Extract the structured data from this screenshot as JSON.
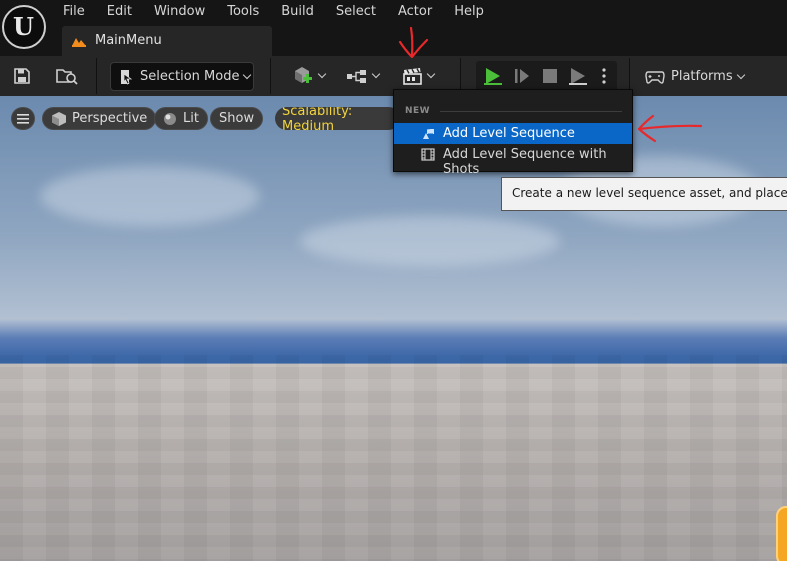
{
  "menu_bar": {
    "items": [
      "File",
      "Edit",
      "Window",
      "Tools",
      "Build",
      "Select",
      "Actor",
      "Help"
    ]
  },
  "document_tab": {
    "label": "MainMenu",
    "icon": "level-icon"
  },
  "toolbar": {
    "selection_mode_label": "Selection Mode",
    "platforms_label": "Platforms",
    "icons": [
      "save-icon",
      "content-browser-icon",
      "add-actor-icon",
      "blueprint-icon",
      "cinematics-icon",
      "play-icon",
      "advance-frame-icon",
      "stop-icon",
      "eject-icon",
      "more-options-icon",
      "platforms-icon"
    ],
    "play_color": "#4cbf3a"
  },
  "viewport": {
    "perspective_label": "Perspective",
    "lit_label": "Lit",
    "show_label": "Show",
    "scalability_label": "Scalability: Medium",
    "scalability_color": "#f2d43d"
  },
  "cinematics_menu": {
    "section_label": "NEW",
    "items": [
      {
        "label": "Add Level Sequence",
        "highlighted": true
      },
      {
        "label": "Add Level Sequence with Shots",
        "highlighted": false
      }
    ],
    "highlight_color": "#0a67c7"
  },
  "tooltip": {
    "text": "Create a new level sequence asset, and place an ins"
  },
  "annotation_color": "#e8282b"
}
